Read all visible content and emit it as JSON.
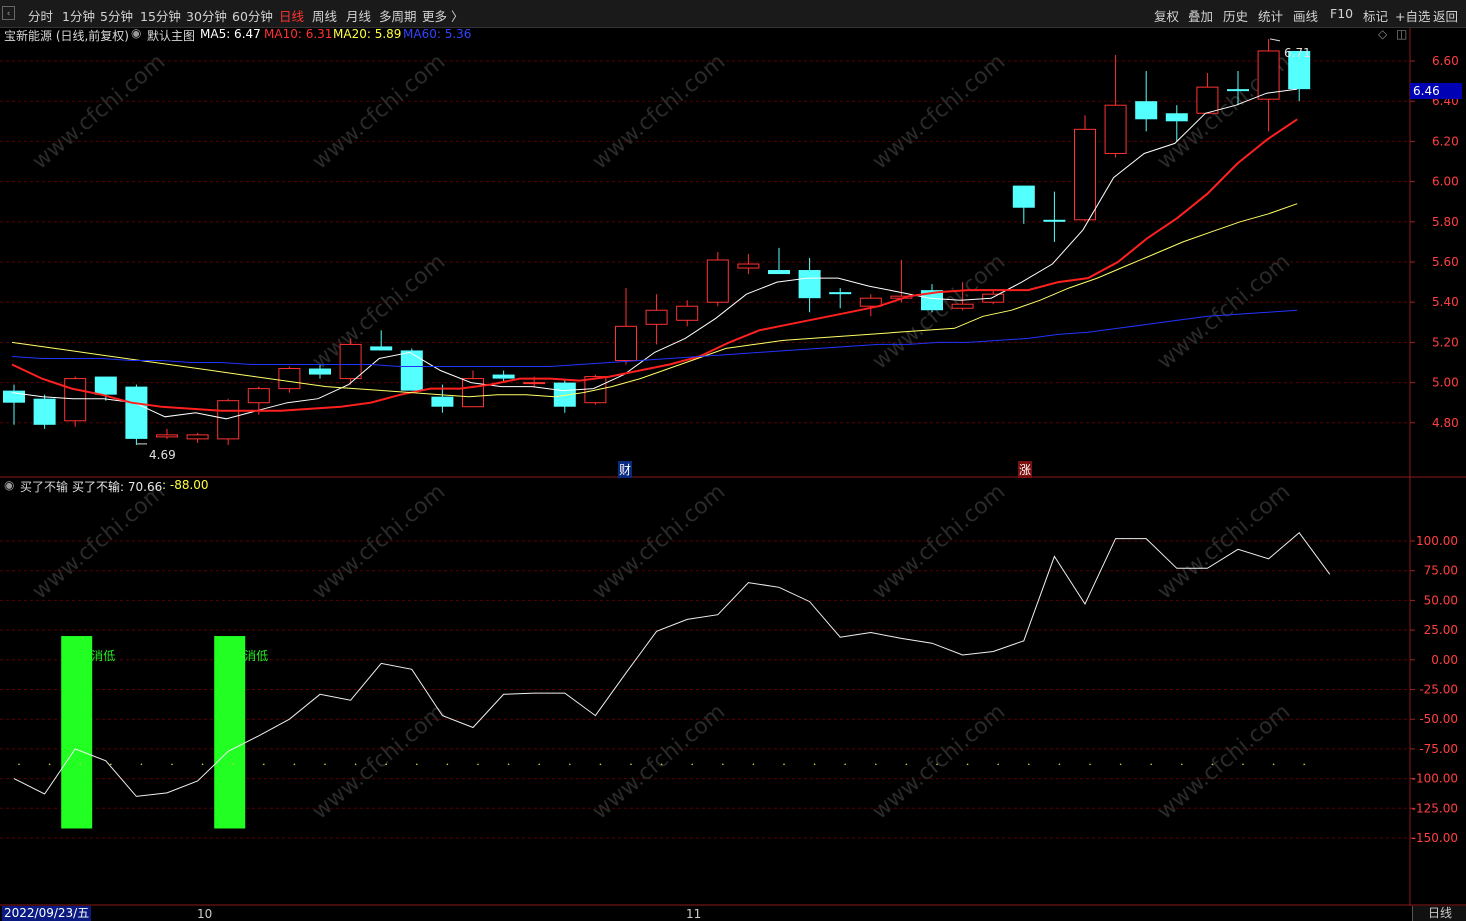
{
  "toolbar": {
    "left_items": [
      "分时",
      "1分钟",
      "5分钟",
      "15分钟",
      "30分钟",
      "60分钟",
      "日线",
      "周线",
      "月线",
      "多周期",
      "更多 〉"
    ],
    "active": "日线",
    "right_items": [
      "复权",
      "叠加",
      "历史",
      "统计",
      "画线",
      "F10",
      "标记",
      "+自选",
      "返回"
    ]
  },
  "main_info": {
    "title": "宝新能源 (日线,前复权)",
    "template": "默认主图",
    "ma5_label": "MA5: 6.47",
    "ma10_label": "MA10: 6.31",
    "ma20_label": "MA20: 5.89",
    "ma60_label": "MA60: 5.36"
  },
  "current_price": "6.46",
  "high_label": "6.71",
  "low_label": "4.69",
  "event_markers": {
    "cai": "财",
    "zhang": "涨"
  },
  "indicator_info": {
    "name": "买了不输",
    "value_label": "买了不输: 70.66",
    "extra": ": -88.00"
  },
  "signal_label": "消低",
  "xaxis": {
    "date": "2022/09/23/五",
    "month1": "10",
    "month2": "11",
    "period_tab": "日线"
  },
  "colors": {
    "up": "#ff3232",
    "down": "#54ffff",
    "ma5": "#ffffff",
    "ma10": "#ff2020",
    "ma20": "#ffff66",
    "ma60": "#2233ff",
    "signal": "#22ff22",
    "grid": "#5a0000"
  },
  "chart_data": [
    {
      "type": "candlestick",
      "y_ticks": [
        4.8,
        5.0,
        5.2,
        5.4,
        5.6,
        5.8,
        6.0,
        6.2,
        6.4,
        6.6
      ],
      "ylim": [
        4.66,
        6.76
      ],
      "candles": [
        {
          "o": 4.96,
          "h": 4.99,
          "l": 4.79,
          "c": 4.9
        },
        {
          "o": 4.92,
          "h": 4.94,
          "l": 4.77,
          "c": 4.79
        },
        {
          "o": 4.81,
          "h": 5.03,
          "l": 4.78,
          "c": 5.02
        },
        {
          "o": 5.03,
          "h": 5.03,
          "l": 4.91,
          "c": 4.94
        },
        {
          "o": 4.98,
          "h": 4.99,
          "l": 4.69,
          "c": 4.72
        },
        {
          "o": 4.73,
          "h": 4.77,
          "l": 4.72,
          "c": 4.74
        },
        {
          "o": 4.72,
          "h": 4.75,
          "l": 4.7,
          "c": 4.74
        },
        {
          "o": 4.72,
          "h": 4.92,
          "l": 4.69,
          "c": 4.91
        },
        {
          "o": 4.9,
          "h": 4.98,
          "l": 4.84,
          "c": 4.97
        },
        {
          "o": 4.97,
          "h": 5.08,
          "l": 4.95,
          "c": 5.07
        },
        {
          "o": 5.07,
          "h": 5.09,
          "l": 5.02,
          "c": 5.04
        },
        {
          "o": 5.02,
          "h": 5.22,
          "l": 4.99,
          "c": 5.19
        },
        {
          "o": 5.18,
          "h": 5.26,
          "l": 5.16,
          "c": 5.16
        },
        {
          "o": 5.16,
          "h": 5.17,
          "l": 4.96,
          "c": 4.96
        },
        {
          "o": 4.93,
          "h": 4.99,
          "l": 4.85,
          "c": 4.88
        },
        {
          "o": 4.88,
          "h": 5.06,
          "l": 4.88,
          "c": 5.02
        },
        {
          "o": 5.04,
          "h": 5.06,
          "l": 5.0,
          "c": 5.02
        },
        {
          "o": 5.0,
          "h": 5.03,
          "l": 4.98,
          "c": 5.0
        },
        {
          "o": 5.0,
          "h": 5.01,
          "l": 4.85,
          "c": 4.88
        },
        {
          "o": 4.9,
          "h": 5.04,
          "l": 4.89,
          "c": 5.03
        },
        {
          "o": 5.11,
          "h": 5.47,
          "l": 5.09,
          "c": 5.28
        },
        {
          "o": 5.29,
          "h": 5.44,
          "l": 5.19,
          "c": 5.36
        },
        {
          "o": 5.31,
          "h": 5.41,
          "l": 5.28,
          "c": 5.38
        },
        {
          "o": 5.4,
          "h": 5.65,
          "l": 5.38,
          "c": 5.61
        },
        {
          "o": 5.57,
          "h": 5.64,
          "l": 5.54,
          "c": 5.59
        },
        {
          "o": 5.56,
          "h": 5.67,
          "l": 5.55,
          "c": 5.54
        },
        {
          "o": 5.56,
          "h": 5.62,
          "l": 5.35,
          "c": 5.42
        },
        {
          "o": 5.45,
          "h": 5.47,
          "l": 5.37,
          "c": 5.44
        },
        {
          "o": 5.38,
          "h": 5.44,
          "l": 5.33,
          "c": 5.42
        },
        {
          "o": 5.42,
          "h": 5.61,
          "l": 5.4,
          "c": 5.43
        },
        {
          "o": 5.46,
          "h": 5.49,
          "l": 5.35,
          "c": 5.36
        },
        {
          "o": 5.37,
          "h": 5.5,
          "l": 5.36,
          "c": 5.39
        },
        {
          "o": 5.4,
          "h": 5.46,
          "l": 5.39,
          "c": 5.44
        },
        {
          "o": 5.98,
          "h": 5.98,
          "l": 5.79,
          "c": 5.87
        },
        {
          "o": 5.81,
          "h": 5.95,
          "l": 5.7,
          "c": 5.8
        },
        {
          "o": 5.81,
          "h": 6.33,
          "l": 5.8,
          "c": 6.26
        },
        {
          "o": 6.14,
          "h": 6.63,
          "l": 6.12,
          "c": 6.38
        },
        {
          "o": 6.4,
          "h": 6.55,
          "l": 6.25,
          "c": 6.31
        },
        {
          "o": 6.34,
          "h": 6.38,
          "l": 6.2,
          "c": 6.3
        },
        {
          "o": 6.34,
          "h": 6.54,
          "l": 6.34,
          "c": 6.47
        },
        {
          "o": 6.46,
          "h": 6.55,
          "l": 6.38,
          "c": 6.45
        },
        {
          "o": 6.41,
          "h": 6.71,
          "l": 6.25,
          "c": 6.65
        },
        {
          "o": 6.65,
          "h": 6.65,
          "l": 6.4,
          "c": 6.46
        }
      ],
      "series": [
        {
          "name": "MA5",
          "values": [
            4.95,
            4.93,
            4.92,
            4.92,
            4.9,
            4.83,
            4.85,
            4.82,
            4.86,
            4.9,
            4.92,
            4.99,
            5.12,
            5.15,
            5.06,
            5.0,
            4.98,
            4.98,
            4.96,
            4.97,
            5.04,
            5.15,
            5.22,
            5.32,
            5.44,
            5.5,
            5.52,
            5.52,
            5.48,
            5.45,
            5.42,
            5.41,
            5.42,
            5.5,
            5.59,
            5.76,
            6.02,
            6.14,
            6.19,
            6.34,
            6.38,
            6.44,
            6.46
          ]
        },
        {
          "name": "MA10",
          "values": [
            5.09,
            5.02,
            4.97,
            4.94,
            4.9,
            4.88,
            4.87,
            4.86,
            4.86,
            4.86,
            4.87,
            4.88,
            4.9,
            4.94,
            4.97,
            4.97,
            4.99,
            5.02,
            5.02,
            5.01,
            5.03,
            5.06,
            5.09,
            5.13,
            5.2,
            5.26,
            5.29,
            5.32,
            5.35,
            5.38,
            5.43,
            5.45,
            5.46,
            5.46,
            5.46,
            5.5,
            5.52,
            5.6,
            5.72,
            5.82,
            5.94,
            6.09,
            6.21,
            6.31
          ]
        },
        {
          "name": "MA20",
          "values": [
            5.2,
            5.18,
            5.16,
            5.14,
            5.12,
            5.1,
            5.08,
            5.06,
            5.04,
            5.02,
            5.0,
            4.98,
            4.97,
            4.96,
            4.95,
            4.94,
            4.93,
            4.94,
            4.94,
            4.93,
            4.95,
            4.98,
            5.02,
            5.07,
            5.12,
            5.17,
            5.19,
            5.21,
            5.22,
            5.23,
            5.24,
            5.25,
            5.26,
            5.27,
            5.33,
            5.36,
            5.41,
            5.47,
            5.52,
            5.58,
            5.64,
            5.7,
            5.75,
            5.8,
            5.84,
            5.89
          ]
        },
        {
          "name": "MA60",
          "values": [
            5.13,
            5.12,
            5.12,
            5.12,
            5.11,
            5.11,
            5.1,
            5.1,
            5.09,
            5.09,
            5.09,
            5.09,
            5.09,
            5.08,
            5.08,
            5.08,
            5.08,
            5.08,
            5.08,
            5.09,
            5.1,
            5.11,
            5.12,
            5.13,
            5.14,
            5.15,
            5.16,
            5.17,
            5.18,
            5.19,
            5.19,
            5.2,
            5.2,
            5.21,
            5.22,
            5.24,
            5.25,
            5.27,
            5.29,
            5.31,
            5.33,
            5.34,
            5.35,
            5.36
          ]
        }
      ]
    },
    {
      "type": "line",
      "name": "买了不输",
      "y_ticks": [
        100,
        75,
        50,
        25,
        0,
        -25,
        -50,
        -75,
        -100,
        -125,
        -150
      ],
      "ylim": [
        -165,
        115
      ],
      "values": [
        -100,
        -113,
        -75,
        -85,
        -115,
        -112,
        -102,
        -77,
        -64,
        -50,
        -29,
        -34,
        -3,
        -8,
        -47,
        -57,
        -29,
        -28,
        -28,
        -47,
        -11,
        24,
        34,
        38,
        65,
        61,
        49,
        19,
        23,
        18,
        14,
        4,
        7,
        16,
        87,
        47,
        102,
        102,
        77,
        77,
        93,
        85,
        107,
        72
      ],
      "dotted_level": -88,
      "signals": [
        {
          "bar": 2,
          "label": "消低",
          "from": -142,
          "to": 20
        },
        {
          "bar": 7,
          "label": "消低",
          "from": -142,
          "to": 20
        }
      ]
    }
  ]
}
